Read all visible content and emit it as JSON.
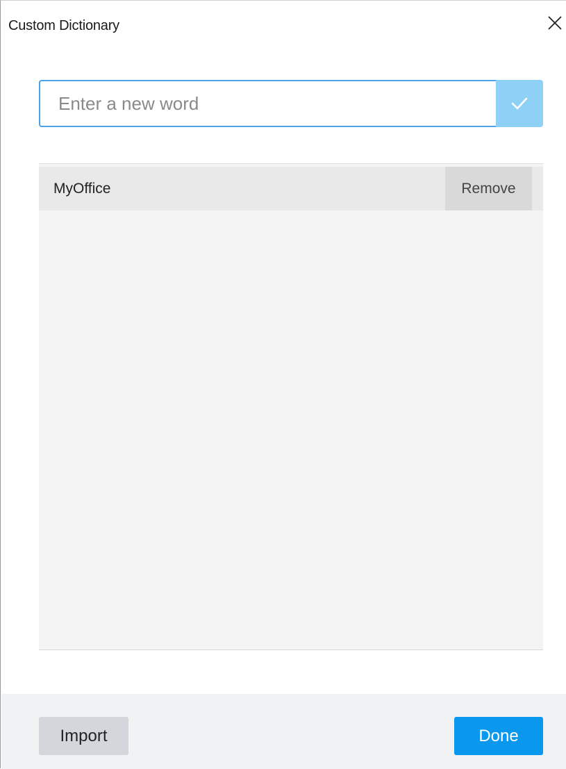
{
  "window": {
    "title": "Custom Dictionary",
    "close_icon": "close-icon"
  },
  "new_word": {
    "value": "",
    "placeholder": "Enter a new word",
    "confirm_icon": "checkmark-icon"
  },
  "dictionary": {
    "words": [
      {
        "word": "MyOffice",
        "remove_label": "Remove"
      }
    ]
  },
  "footer": {
    "import_label": "Import",
    "done_label": "Done"
  },
  "colors": {
    "accent": "#0a98ee",
    "input_border": "#4aa3e8",
    "confirm_button": "#8fd0f7",
    "secondary_button": "#d3d7db"
  }
}
